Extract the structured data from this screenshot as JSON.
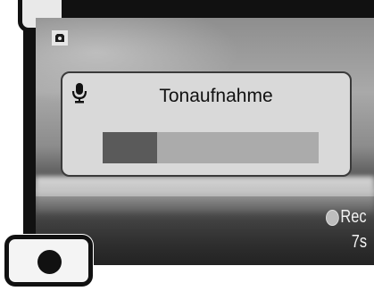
{
  "screen": {
    "mode_icon": "camera-icon"
  },
  "dialog": {
    "icon": "microphone-icon",
    "title": "Tonaufnahme",
    "progress_fraction": 0.25
  },
  "status": {
    "rec_indicator_icon": "record-indicator-icon",
    "rec_label": "Rec",
    "time_label": "7s"
  },
  "controls": {
    "record_button_icon": "record-icon"
  },
  "colors": {
    "progress_fill": "#5a5a5a",
    "progress_track": "#ababab",
    "dialog_background": "#d9d9d9"
  }
}
